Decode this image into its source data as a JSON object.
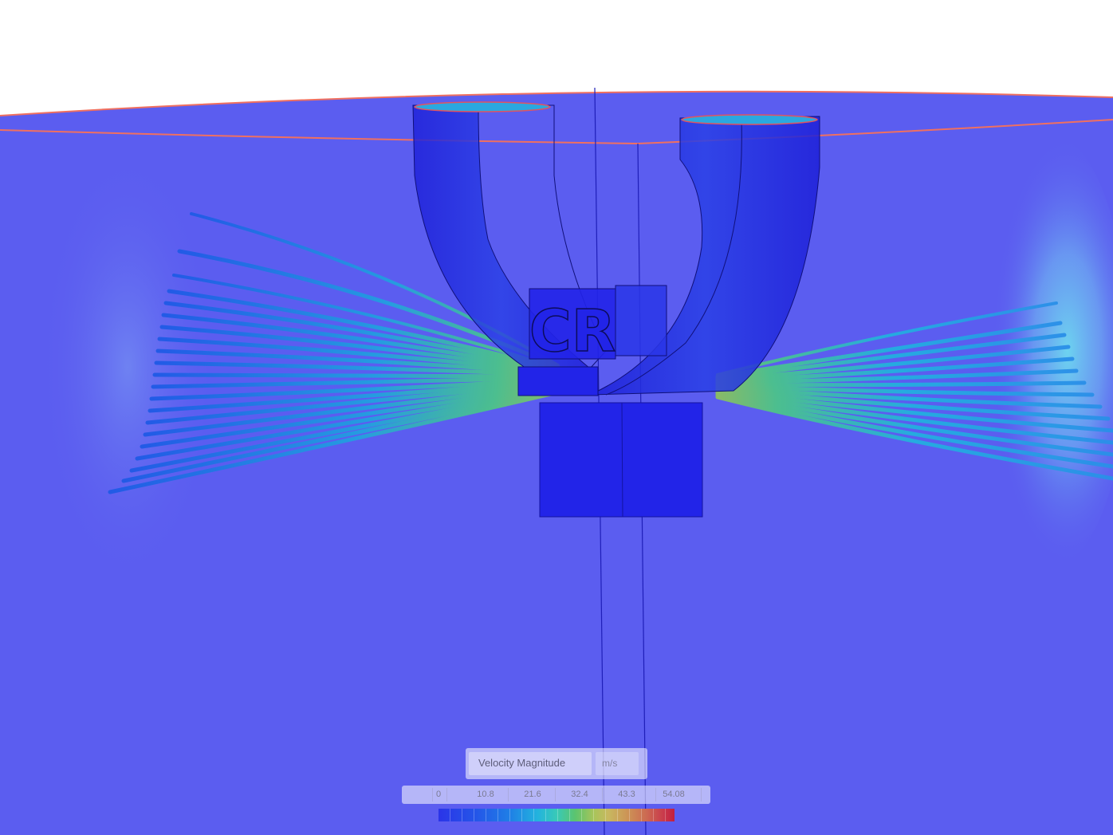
{
  "viewer": {
    "background_top": "#ffffff",
    "domain_color": "#5b5df0",
    "geometry_color": "#2224e8",
    "free_surface_color": "#f07060"
  },
  "geometry_logo": {
    "text": "CR"
  },
  "legend": {
    "field": "Velocity Magnitude",
    "unit": "m/s",
    "ticks": [
      "0",
      "10.8",
      "21.6",
      "32.4",
      "43.3",
      "54.08"
    ],
    "min": 0,
    "max": 54.08,
    "colormap": [
      "#2b34e8",
      "#2456e8",
      "#1f7ee6",
      "#23b3de",
      "#38c9b8",
      "#5cc46e",
      "#a9c45a",
      "#c8b860",
      "#cc9456",
      "#cc6a52",
      "#c93c4c",
      "#c21e3f"
    ]
  }
}
